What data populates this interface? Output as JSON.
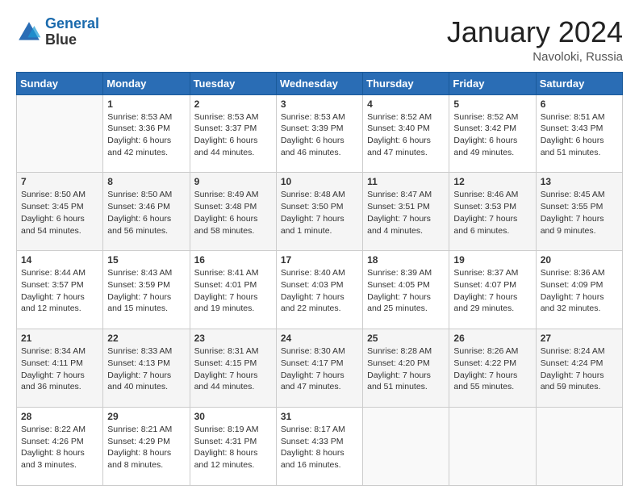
{
  "header": {
    "logo_line1": "General",
    "logo_line2": "Blue",
    "title": "January 2024",
    "subtitle": "Navoloki, Russia"
  },
  "columns": [
    "Sunday",
    "Monday",
    "Tuesday",
    "Wednesday",
    "Thursday",
    "Friday",
    "Saturday"
  ],
  "weeks": [
    [
      {
        "day": "",
        "sunrise": "",
        "sunset": "",
        "daylight": ""
      },
      {
        "day": "1",
        "sunrise": "Sunrise: 8:53 AM",
        "sunset": "Sunset: 3:36 PM",
        "daylight": "Daylight: 6 hours and 42 minutes."
      },
      {
        "day": "2",
        "sunrise": "Sunrise: 8:53 AM",
        "sunset": "Sunset: 3:37 PM",
        "daylight": "Daylight: 6 hours and 44 minutes."
      },
      {
        "day": "3",
        "sunrise": "Sunrise: 8:53 AM",
        "sunset": "Sunset: 3:39 PM",
        "daylight": "Daylight: 6 hours and 46 minutes."
      },
      {
        "day": "4",
        "sunrise": "Sunrise: 8:52 AM",
        "sunset": "Sunset: 3:40 PM",
        "daylight": "Daylight: 6 hours and 47 minutes."
      },
      {
        "day": "5",
        "sunrise": "Sunrise: 8:52 AM",
        "sunset": "Sunset: 3:42 PM",
        "daylight": "Daylight: 6 hours and 49 minutes."
      },
      {
        "day": "6",
        "sunrise": "Sunrise: 8:51 AM",
        "sunset": "Sunset: 3:43 PM",
        "daylight": "Daylight: 6 hours and 51 minutes."
      }
    ],
    [
      {
        "day": "7",
        "sunrise": "Sunrise: 8:50 AM",
        "sunset": "Sunset: 3:45 PM",
        "daylight": "Daylight: 6 hours and 54 minutes."
      },
      {
        "day": "8",
        "sunrise": "Sunrise: 8:50 AM",
        "sunset": "Sunset: 3:46 PM",
        "daylight": "Daylight: 6 hours and 56 minutes."
      },
      {
        "day": "9",
        "sunrise": "Sunrise: 8:49 AM",
        "sunset": "Sunset: 3:48 PM",
        "daylight": "Daylight: 6 hours and 58 minutes."
      },
      {
        "day": "10",
        "sunrise": "Sunrise: 8:48 AM",
        "sunset": "Sunset: 3:50 PM",
        "daylight": "Daylight: 7 hours and 1 minute."
      },
      {
        "day": "11",
        "sunrise": "Sunrise: 8:47 AM",
        "sunset": "Sunset: 3:51 PM",
        "daylight": "Daylight: 7 hours and 4 minutes."
      },
      {
        "day": "12",
        "sunrise": "Sunrise: 8:46 AM",
        "sunset": "Sunset: 3:53 PM",
        "daylight": "Daylight: 7 hours and 6 minutes."
      },
      {
        "day": "13",
        "sunrise": "Sunrise: 8:45 AM",
        "sunset": "Sunset: 3:55 PM",
        "daylight": "Daylight: 7 hours and 9 minutes."
      }
    ],
    [
      {
        "day": "14",
        "sunrise": "Sunrise: 8:44 AM",
        "sunset": "Sunset: 3:57 PM",
        "daylight": "Daylight: 7 hours and 12 minutes."
      },
      {
        "day": "15",
        "sunrise": "Sunrise: 8:43 AM",
        "sunset": "Sunset: 3:59 PM",
        "daylight": "Daylight: 7 hours and 15 minutes."
      },
      {
        "day": "16",
        "sunrise": "Sunrise: 8:41 AM",
        "sunset": "Sunset: 4:01 PM",
        "daylight": "Daylight: 7 hours and 19 minutes."
      },
      {
        "day": "17",
        "sunrise": "Sunrise: 8:40 AM",
        "sunset": "Sunset: 4:03 PM",
        "daylight": "Daylight: 7 hours and 22 minutes."
      },
      {
        "day": "18",
        "sunrise": "Sunrise: 8:39 AM",
        "sunset": "Sunset: 4:05 PM",
        "daylight": "Daylight: 7 hours and 25 minutes."
      },
      {
        "day": "19",
        "sunrise": "Sunrise: 8:37 AM",
        "sunset": "Sunset: 4:07 PM",
        "daylight": "Daylight: 7 hours and 29 minutes."
      },
      {
        "day": "20",
        "sunrise": "Sunrise: 8:36 AM",
        "sunset": "Sunset: 4:09 PM",
        "daylight": "Daylight: 7 hours and 32 minutes."
      }
    ],
    [
      {
        "day": "21",
        "sunrise": "Sunrise: 8:34 AM",
        "sunset": "Sunset: 4:11 PM",
        "daylight": "Daylight: 7 hours and 36 minutes."
      },
      {
        "day": "22",
        "sunrise": "Sunrise: 8:33 AM",
        "sunset": "Sunset: 4:13 PM",
        "daylight": "Daylight: 7 hours and 40 minutes."
      },
      {
        "day": "23",
        "sunrise": "Sunrise: 8:31 AM",
        "sunset": "Sunset: 4:15 PM",
        "daylight": "Daylight: 7 hours and 44 minutes."
      },
      {
        "day": "24",
        "sunrise": "Sunrise: 8:30 AM",
        "sunset": "Sunset: 4:17 PM",
        "daylight": "Daylight: 7 hours and 47 minutes."
      },
      {
        "day": "25",
        "sunrise": "Sunrise: 8:28 AM",
        "sunset": "Sunset: 4:20 PM",
        "daylight": "Daylight: 7 hours and 51 minutes."
      },
      {
        "day": "26",
        "sunrise": "Sunrise: 8:26 AM",
        "sunset": "Sunset: 4:22 PM",
        "daylight": "Daylight: 7 hours and 55 minutes."
      },
      {
        "day": "27",
        "sunrise": "Sunrise: 8:24 AM",
        "sunset": "Sunset: 4:24 PM",
        "daylight": "Daylight: 7 hours and 59 minutes."
      }
    ],
    [
      {
        "day": "28",
        "sunrise": "Sunrise: 8:22 AM",
        "sunset": "Sunset: 4:26 PM",
        "daylight": "Daylight: 8 hours and 3 minutes."
      },
      {
        "day": "29",
        "sunrise": "Sunrise: 8:21 AM",
        "sunset": "Sunset: 4:29 PM",
        "daylight": "Daylight: 8 hours and 8 minutes."
      },
      {
        "day": "30",
        "sunrise": "Sunrise: 8:19 AM",
        "sunset": "Sunset: 4:31 PM",
        "daylight": "Daylight: 8 hours and 12 minutes."
      },
      {
        "day": "31",
        "sunrise": "Sunrise: 8:17 AM",
        "sunset": "Sunset: 4:33 PM",
        "daylight": "Daylight: 8 hours and 16 minutes."
      },
      {
        "day": "",
        "sunrise": "",
        "sunset": "",
        "daylight": ""
      },
      {
        "day": "",
        "sunrise": "",
        "sunset": "",
        "daylight": ""
      },
      {
        "day": "",
        "sunrise": "",
        "sunset": "",
        "daylight": ""
      }
    ]
  ]
}
